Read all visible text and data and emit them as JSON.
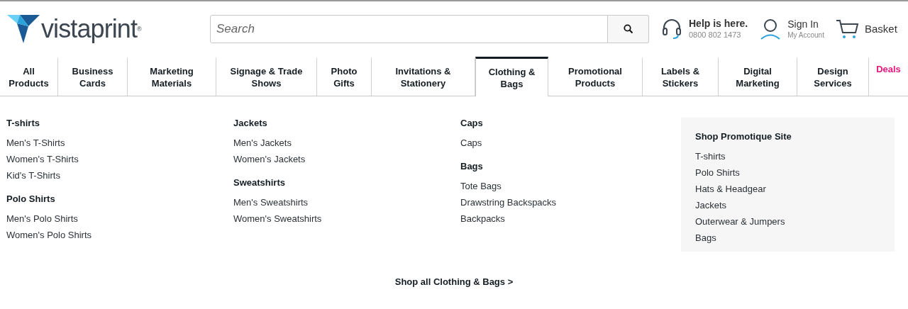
{
  "header": {
    "logo": {
      "wordmark": "vistaprint",
      "mark": "®"
    },
    "search": {
      "placeholder": "Search"
    },
    "help": {
      "title": "Help is here.",
      "phone": "0800 802 1473"
    },
    "account": {
      "title": "Sign In",
      "subtitle": "My Account"
    },
    "basket": {
      "label": "Basket"
    }
  },
  "nav": [
    {
      "label": "All Products",
      "selected": false,
      "kind": "normal"
    },
    {
      "label": "Business Cards",
      "selected": false,
      "kind": "normal"
    },
    {
      "label": "Marketing Materials",
      "selected": false,
      "kind": "normal"
    },
    {
      "label": "Signage & Trade Shows",
      "selected": false,
      "kind": "normal"
    },
    {
      "label": "Photo Gifts",
      "selected": false,
      "kind": "normal"
    },
    {
      "label": "Invitations & Stationery",
      "selected": false,
      "kind": "normal"
    },
    {
      "label": "Clothing & Bags",
      "selected": true,
      "kind": "normal"
    },
    {
      "label": "Promotional Products",
      "selected": false,
      "kind": "normal"
    },
    {
      "label": "Labels & Stickers",
      "selected": false,
      "kind": "normal"
    },
    {
      "label": "Digital Marketing",
      "selected": false,
      "kind": "normal"
    },
    {
      "label": "Design Services",
      "selected": false,
      "kind": "normal"
    },
    {
      "label": "Deals",
      "selected": false,
      "kind": "deal"
    }
  ],
  "menu": {
    "columns": [
      {
        "kind": "plain",
        "groups": [
          {
            "heading": "T-shirts",
            "links": [
              "Men's T-Shirts",
              "Women's T-Shirts",
              "Kid's T-Shirts"
            ]
          },
          {
            "heading": "Polo Shirts",
            "links": [
              "Men's Polo Shirts",
              "Women's Polo Shirts"
            ]
          }
        ]
      },
      {
        "kind": "plain",
        "groups": [
          {
            "heading": "Jackets",
            "links": [
              "Men's Jackets",
              "Women's Jackets"
            ]
          },
          {
            "heading": "Sweatshirts",
            "links": [
              "Men's Sweatshirts",
              "Women's Sweatshirts"
            ]
          }
        ]
      },
      {
        "kind": "plain",
        "groups": [
          {
            "heading": "Caps",
            "links": [
              "Caps"
            ]
          },
          {
            "heading": "Bags",
            "links": [
              "Tote Bags",
              "Drawstring Backspacks",
              "Backpacks"
            ]
          }
        ]
      },
      {
        "kind": "panel",
        "groups": [
          {
            "heading": "Shop Promotique Site",
            "links": [
              "T-shirts",
              "Polo Shirts",
              "Hats & Headgear",
              "Jackets",
              "Outerwear & Jumpers",
              "Bags"
            ]
          }
        ]
      }
    ],
    "shop_all": "Shop all Clothing & Bags >"
  }
}
